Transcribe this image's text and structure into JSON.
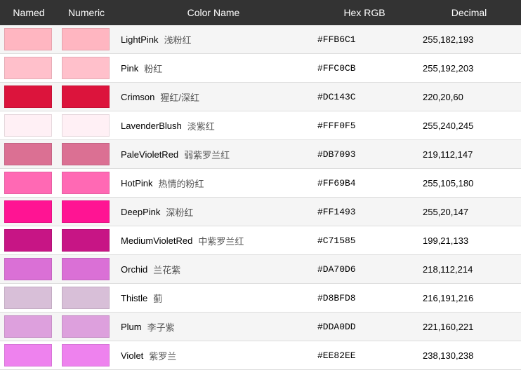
{
  "header": {
    "named": "Named",
    "numeric": "Numeric",
    "colorName": "Color Name",
    "hexRgb": "Hex RGB",
    "decimal": "Decimal"
  },
  "colors": [
    {
      "namedSwatch": "#FFB6C1",
      "numericSwatch": "#FFB6C1",
      "nameEn": "LightPink",
      "nameZh": "浅粉红",
      "hex": "#FFB6C1",
      "decimal": "255,182,193"
    },
    {
      "namedSwatch": "#FFC0CB",
      "numericSwatch": "#FFC0CB",
      "nameEn": "Pink",
      "nameZh": "粉红",
      "hex": "#FFC0CB",
      "decimal": "255,192,203"
    },
    {
      "namedSwatch": "#DC143C",
      "numericSwatch": "#DC143C",
      "nameEn": "Crimson",
      "nameZh": "猩红/深红",
      "hex": "#DC143C",
      "decimal": "220,20,60"
    },
    {
      "namedSwatch": "#FFF0F5",
      "numericSwatch": "#FFF0F5",
      "nameEn": "LavenderBlush",
      "nameZh": "淡紫红",
      "hex": "#FFF0F5",
      "decimal": "255,240,245"
    },
    {
      "namedSwatch": "#DB7093",
      "numericSwatch": "#DB7093",
      "nameEn": "PaleVioletRed",
      "nameZh": "弱紫罗兰红",
      "hex": "#DB7093",
      "decimal": "219,112,147"
    },
    {
      "namedSwatch": "#FF69B4",
      "numericSwatch": "#FF69B4",
      "nameEn": "HotPink",
      "nameZh": "热情的粉红",
      "hex": "#FF69B4",
      "decimal": "255,105,180"
    },
    {
      "namedSwatch": "#FF1493",
      "numericSwatch": "#FF1493",
      "nameEn": "DeepPink",
      "nameZh": "深粉红",
      "hex": "#FF1493",
      "decimal": "255,20,147"
    },
    {
      "namedSwatch": "#C71585",
      "numericSwatch": "#C71585",
      "nameEn": "MediumVioletRed",
      "nameZh": "中紫罗兰红",
      "hex": "#C71585",
      "decimal": "199,21,133"
    },
    {
      "namedSwatch": "#DA70D6",
      "numericSwatch": "#DA70D6",
      "nameEn": "Orchid",
      "nameZh": "兰花紫",
      "hex": "#DA70D6",
      "decimal": "218,112,214"
    },
    {
      "namedSwatch": "#D8BFD8",
      "numericSwatch": "#D8BFD8",
      "nameEn": "Thistle",
      "nameZh": "蓟",
      "hex": "#D8BFD8",
      "decimal": "216,191,216"
    },
    {
      "namedSwatch": "#DDA0DD",
      "numericSwatch": "#DDA0DD",
      "nameEn": "Plum",
      "nameZh": "李子紫",
      "hex": "#DDA0DD",
      "decimal": "221,160,221"
    },
    {
      "namedSwatch": "#EE82EE",
      "numericSwatch": "#EE82EE",
      "nameEn": "Violet",
      "nameZh": "紫罗兰",
      "hex": "#EE82EE",
      "decimal": "238,130,238"
    }
  ]
}
